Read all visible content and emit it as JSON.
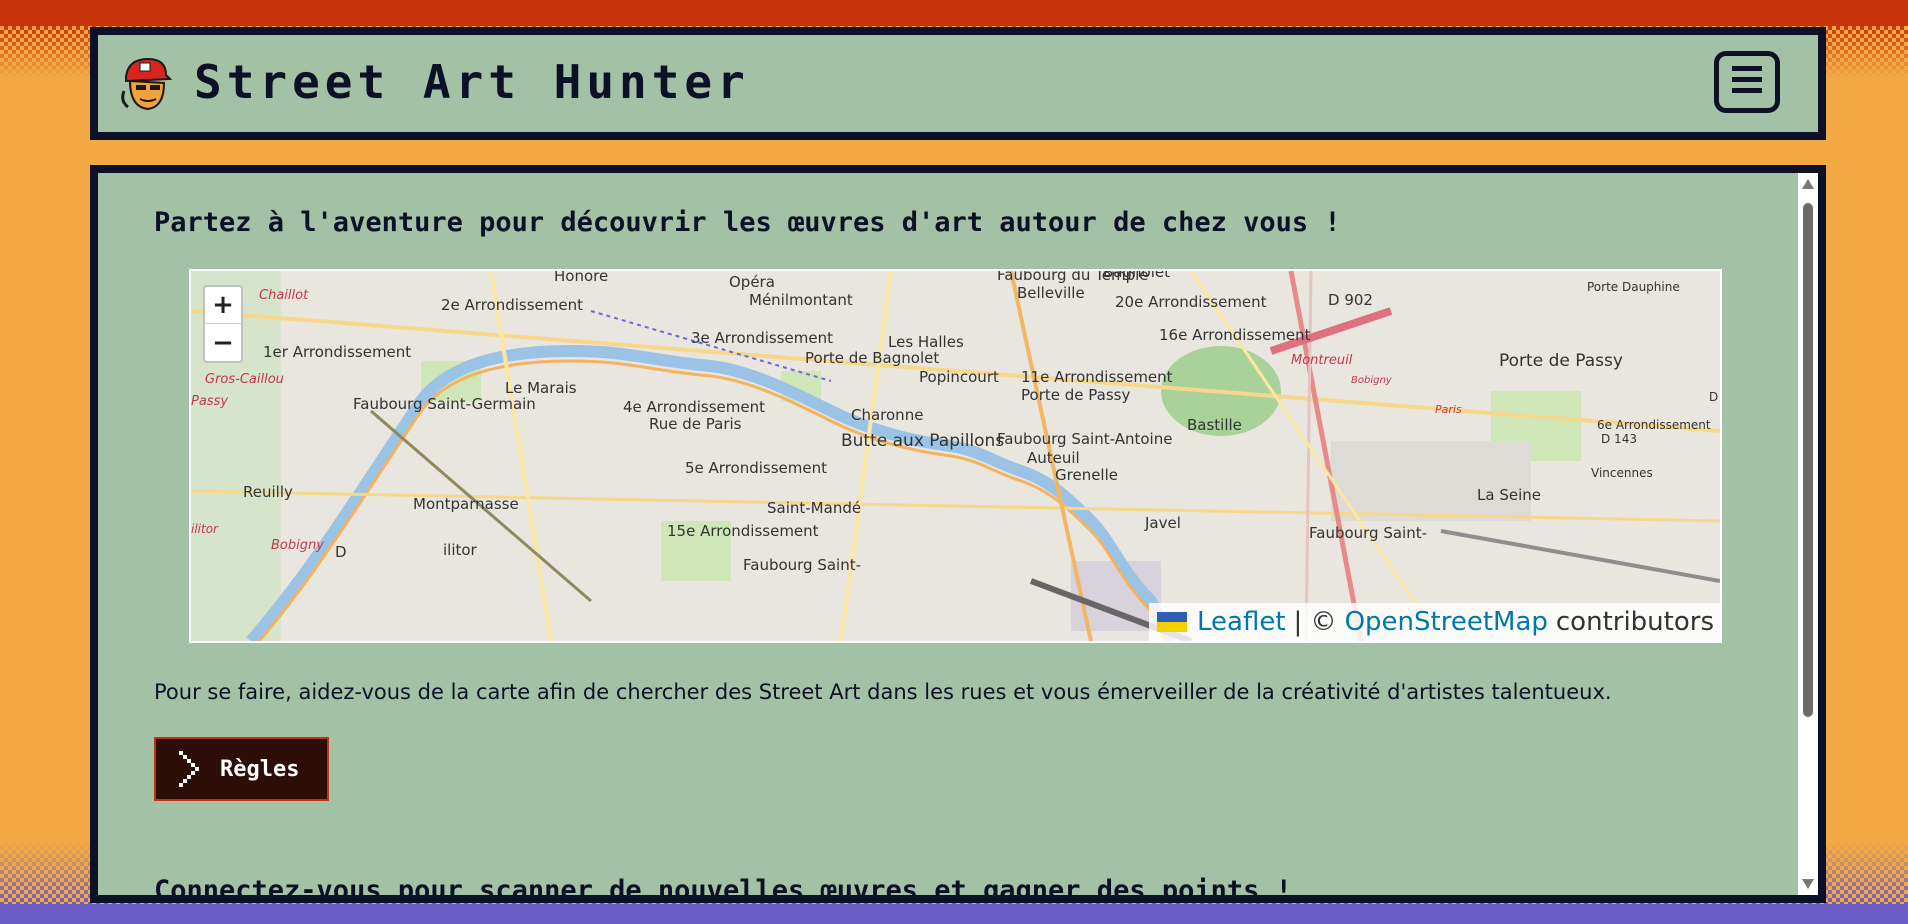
{
  "site": {
    "title": "Street Art Hunter",
    "menu_icon": "hamburger-menu-icon"
  },
  "main": {
    "heading": "Partez à l'aventure pour découvrir les œuvres d'art autour de chez vous !",
    "intro": "Pour se faire, aidez-vous de la carte afin de chercher des Street Art dans les rues et vous émerveiller de la créativité d'artistes talentueux.",
    "rules_button": "Règles",
    "login_heading": "Connectez-vous pour scanner de nouvelles œuvres et gagner des points !"
  },
  "map": {
    "zoom_in": "+",
    "zoom_out": "−",
    "attribution": {
      "leaflet": "Leaflet",
      "separator": "| ©",
      "osm": "OpenStreetMap",
      "contributors": "contributors"
    },
    "labels": [
      "Honore",
      "Opéra",
      "Faubourg du Temple",
      "Belleville",
      "Bagnolet",
      "D 902",
      "Porte Dauphine",
      "Chaillot",
      "2e Arrondissement",
      "Ménilmontant",
      "20e Arrondissement",
      "16e Arrondissement",
      "1er Arrondissement",
      "3e Arrondissement",
      "Les Halles",
      "Porte de Bagnolet",
      "Montreuil",
      "Porte de Passy",
      "Gros-Caillou",
      "Le Marais",
      "Popincourt",
      "11e Arrondissement",
      "Porte de Passy",
      "Passy",
      "Faubourg Saint-Germain",
      "4e Arrondissement",
      "Rue de Paris",
      "Charonne",
      "Paris",
      "Bastille",
      "Butte aux Papillons",
      "Faubourg Saint-Antoine",
      "6e Arrondissement",
      "D 143",
      "Auteuil",
      "Grenelle",
      "5e Arrondissement",
      "Vincennes",
      "Reuilly",
      "Montparnasse",
      "Saint-Mandé",
      "La Seine",
      "Javel",
      "15e Arrondissement",
      "Faubourg Saint-",
      "Bobigny",
      "D",
      "ilitor"
    ]
  },
  "colors": {
    "background": "#f2a944",
    "top_band": "#c8350a",
    "bottom_band": "#6a5cc4",
    "panel": "#a3c1a4",
    "border": "#0d1128",
    "button_bg": "#2c0e06",
    "button_border": "#c33012",
    "link": "#0078a8"
  }
}
